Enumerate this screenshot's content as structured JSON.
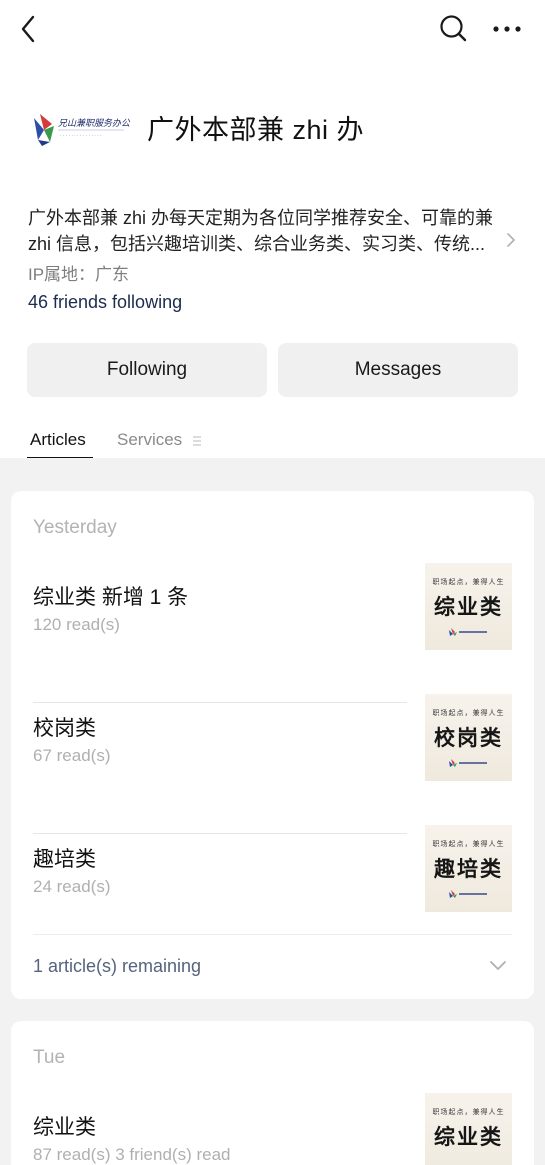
{
  "header": {
    "back_icon": "chevron-left-icon",
    "search_icon": "search-icon",
    "more_icon": "more-dots-icon"
  },
  "profile": {
    "name": "广外本部兼 zhi 办",
    "logo_text": "兄山兼职服务办公室",
    "bio_line1": "广外本部兼 zhi 办每天定期为各位同学推荐安全、可靠的兼",
    "bio_line2": "zhi 信息，包括兴趣培训类、综合业务类、实习类、传统...",
    "ip_location": "IP属地：广东",
    "friends_following": "46 friends following"
  },
  "actions": {
    "following_label": "Following",
    "messages_label": "Messages"
  },
  "tabs": {
    "articles": "Articles",
    "services": "Services"
  },
  "feed": {
    "groups": [
      {
        "date": "Yesterday",
        "articles": [
          {
            "title": "综业类 新增 1 条",
            "meta": "120 read(s)",
            "thumb_top": "职场起点，兼得人生",
            "thumb_big": "综业类"
          },
          {
            "title": "校岗类",
            "meta": "67 read(s)",
            "thumb_top": "职场起点，兼得人生",
            "thumb_big": "校岗类"
          },
          {
            "title": "趣培类",
            "meta": "24 read(s)",
            "thumb_top": "职场起点，兼得人生",
            "thumb_big": "趣培类"
          }
        ],
        "remaining": "1 article(s) remaining"
      },
      {
        "date": "Tue",
        "articles": [
          {
            "title": "综业类",
            "meta": "87 read(s)   3 friend(s) read",
            "thumb_top": "职场起点，兼得人生",
            "thumb_big": "综业类"
          }
        ]
      }
    ]
  },
  "colors": {
    "feed_bg": "#f2f2f2",
    "link_text": "#1b2c4f",
    "button_bg": "#f0f0f0"
  }
}
